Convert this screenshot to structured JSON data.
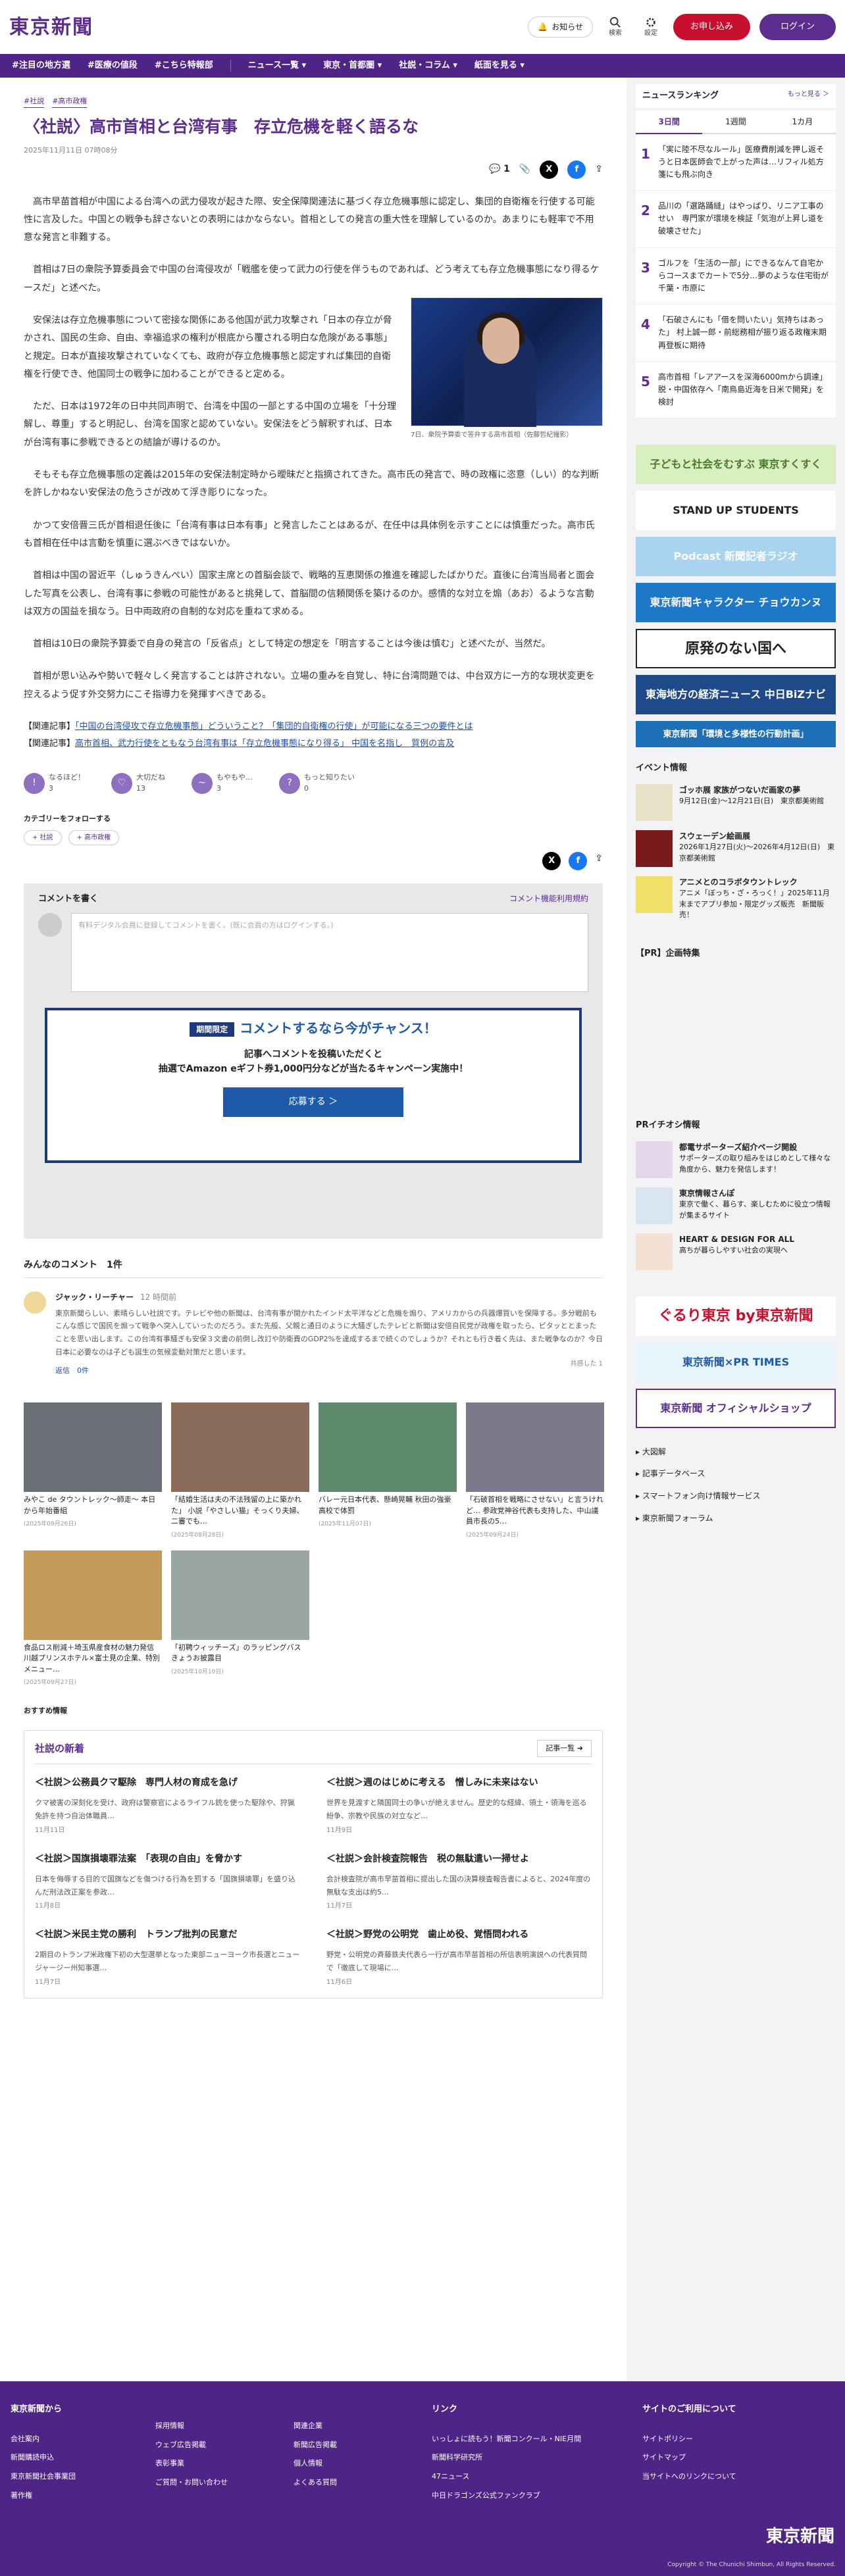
{
  "header": {
    "logo": "東京新聞",
    "notice": "お知らせ",
    "search": "検索",
    "settings": "設定",
    "subscribe": "お申し込み",
    "login": "ログイン"
  },
  "nav": [
    "#注目の地方選",
    "#医療の値段",
    "#こちら特報部",
    "ニュース一覧 ▾",
    "東京・首都圏 ▾",
    "社説・コラム ▾",
    "紙面を見る ▾"
  ],
  "article": {
    "tags": [
      "#社説",
      "#高市政権"
    ],
    "title": "〈社説〉高市首相と台湾有事　存立危機を軽く語るな",
    "date": "2025年11月11日 07時08分",
    "comments_count": "1",
    "paragraphs": [
      "高市早苗首相が中国による台湾への武力侵攻が起きた際、安全保障関連法に基づく存立危機事態に認定し、集団的自衛権を行使する可能性に言及した。中国との戦争も辞さないとの表明にはかならない。首相としての発言の重大性を理解しているのか。あまりにも軽率で不用意な発言と非難する。",
      "首相は7日の衆院予算委員会で中国の台湾侵攻が「戦艦を使って武力の行使を伴うものであれば、どう考えても存立危機事態になり得るケースだ」と述べた。",
      "安保法は存立危機事態について密接な関係にある他国が武力攻撃され「日本の存立が脅かされ、国民の生命、自由、幸福追求の権利が根底から覆される明白な危険がある事態」と規定。日本が直接攻撃されていなくても、政府が存立危機事態と認定すれば集団的自衛権を行使でき、他国同士の戦争に加わることができると定める。",
      "ただ、日本は1972年の日中共同声明で、台湾を中国の一部とする中国の立場を「十分理解し、尊重」すると明記し、台湾を国家と認めていない。安保法をどう解釈すれば、日本が台湾有事に参戦できるとの結論が導けるのか。",
      "そもそも存立危機事態の定義は2015年の安保法制定時から曖昧だと指摘されてきた。高市氏の発言で、時の政権に恣意（しい）的な判断を許しかねない安保法の危うさが改めて浮き彫りになった。",
      "かつて安倍晋三氏が首相退任後に「台湾有事は日本有事」と発言したことはあるが、在任中は具体例を示すことには慎重だった。高市氏も首相在任中は言動を慎重に選ぶべきではないか。",
      "首相は中国の習近平（しゅうきんぺい）国家主席との首脳会談で、戦略的互恵関係の推進を確認したばかりだ。直後に台湾当局者と面会した写真を公表し、台湾有事に参戦の可能性があると挑発して、首脳間の信頼関係を築けるのか。感情的な対立を煽（あお）るような言動は双方の国益を損なう。日中両政府の自制的な対応を重ねて求める。",
      "首相は10日の衆院予算委で自身の発言の「反省点」として特定の想定を「明言することは今後は慎む」と述べたが、当然だ。",
      "首相が思い込みや勢いで軽々しく発言することは許されない。立場の重みを自覚し、特に台湾問題では、中台双方に一方的な現状変更を控えるよう促す外交努力にこそ指導力を発揮すべきである。"
    ],
    "fig_caption": "7日、衆院予算委で答弁する高市首相（佐藤哲紀撮影）",
    "related": [
      {
        "label": "【関連記事】",
        "text": "「中国の台湾侵攻で存立危機事態」どういうこと？「集団的自衛権の行使」が可能になる三つの要件とは"
      },
      {
        "label": "【関連記事】",
        "text": "高市首相、武力行使をともなう台湾有事は「存立危機事態になり得る」 中国を名指し　質例の言及"
      }
    ],
    "reactions": [
      {
        "label": "なるほど！",
        "n": "3"
      },
      {
        "label": "大切だね",
        "n": "13"
      },
      {
        "label": "もやもや…",
        "n": "3"
      },
      {
        "label": "もっと知りたい",
        "n": "0"
      }
    ],
    "follow_label": "カテゴリーをフォローする",
    "follow_tags": [
      "+ 社説",
      "+ 高市政権"
    ]
  },
  "comments": {
    "write": "コメントを書く",
    "policy": "コメント機能利用規約",
    "input": "有料デジタル会員に登録してコメントを書く。(既に会員の方はログインする。)",
    "camp_badge": "期間限定",
    "camp_title": "コメントするなら今がチャンス！",
    "camp_desc": "記事へコメントを投稿いただくと\n抽選でAmazon eギフト券1,000円分などが当たるキャンペーン実施中！",
    "camp_btn": "応募する ＞",
    "header": "みんなのコメント　1件",
    "user": "ジャック・リーチャー",
    "time": "12 時間前",
    "text": "東京新聞らしい、素晴らしい社説です。テレビや他の新聞は、台湾有事が開かれたインド太平洋などと危機を煽り、アメリカからの兵器爆買いを保障する。多分戦前もこんな感じで国民を煽って戦争へ突入していったのだろう。また先般、父親と通日のように大騒ぎしたテレビと新聞は安倍自民党が政権を取ったら、ピタッととまったことを思い出します。この台湾有事騒ぎも安保３文書の前倒し改訂や防衛費のGDP2%を達成するまで続くのでしょうか？それとも行き着く先は、また戦争なのか？今日日本に必要なのは子ども誕生の気候変動対策だと思います。",
    "reply": "返信　0件",
    "flag": "共感した 1"
  },
  "cards": [
    {
      "t": "みやこ de タウントレック〜師走〜 本日から年始番組",
      "d": "(2025年09月26日)"
    },
    {
      "t": "「結婚生活は夫の不法残留の上に築かれた」 小説「やさしい猫」そっくり夫婦、二審でも…",
      "d": "(2025年08月28日)"
    },
    {
      "t": "バレー元日本代表、懸崎晃輔 秋田の強豪高校で体罰",
      "d": "(2025年11月07日)"
    },
    {
      "t": "「石破首相を戦略にさせない」と言うけれど… 参政党神谷代表も支持した、中山議員市長の5…",
      "d": "(2025年09月24日)"
    },
    {
      "t": "食品ロス削減＋埼玉県産食材の魅力発信 川越プリンスホテル×富士見の企業、特別メニュー…",
      "d": "(2025年09月27日)"
    },
    {
      "t": "「初聘ウィッチーズ」のラッピングバス きょうお披露目",
      "d": "(2025年10月10日)"
    }
  ],
  "recommend": "おすすめ情報",
  "shinchaku": {
    "title": "社説の新着",
    "more": "記事一覧 ➜",
    "items": [
      {
        "t": "＜社説＞公務員クマ駆除　専門人材の育成を急げ",
        "d": "クマ被害の深刻化を受け、政府は警察官によるライフル銃を使った駆除や、狩猟免許を持つ自治体職員…",
        "dt": "11月11日"
      },
      {
        "t": "＜社説＞週のはじめに考える　憎しみに未来はない",
        "d": "世界を見渡すと隣国同士の争いが絶えません。歴史的な経緯、領土・領海を巡る紛争、宗教や民族の対立など…",
        "dt": "11月9日"
      },
      {
        "t": "＜社説＞国旗損壊罪法案　「表現の自由」を脅かす",
        "d": "日本を侮辱する目的で国旗などを傷つける行為を罰する「国旗損壊罪」を盛り込んだ刑法改正案を参政…",
        "dt": "11月8日"
      },
      {
        "t": "＜社説＞会計検査院報告　税の無駄遣い一掃せよ",
        "d": "会計検査院が高市早苗首相に提出した国の決算検査報告書によると、2024年度の無駄な支出は約5…",
        "dt": "11月7日"
      },
      {
        "t": "＜社説＞米民主党の勝利　トランプ批判の民意だ",
        "d": "2期目のトランプ米政権下初の大型選挙となった東部ニューヨーク市長選とニュージャージー州知事選…",
        "dt": "11月7日"
      },
      {
        "t": "＜社説＞野党の公明党　歯止め役、覚悟問われる",
        "d": "野党・公明党の斉藤鉄夫代表ら一行が高市早苗首相の所信表明演説への代表質問で「徹底して現場に…",
        "dt": "11月6日"
      }
    ]
  },
  "ranking": {
    "title": "ニュースランキング",
    "more": "もっと見る ＞",
    "tabs": [
      "3日間",
      "1週間",
      "1カ月"
    ],
    "items": [
      "「実に陸不尽なルール」医療費削減を押し返そうと日本医師会で上がった声は…リフィル処方箋にも飛ぶ向き",
      "品川の「選路踊縫」はやっぱり、リニア工事のせい　専門家が環境を検証「気泡が上昇し道を破壊させた」",
      "ゴルフを「生活の一部」にできるなんて自宅からコースまでカートで5分…夢のような住宅街が千葉・市原に",
      "「石破さんにも「借を問いたい」気持ちはあった」 村上誠一郎・前総務相が振り返る政権末期　再登板に期待",
      "高市首相「レアアースを深海6000mから調達」 脱・中国依存へ「南鳥島近海を日米で開発」を検討"
    ]
  },
  "side_ads": [
    "子どもと社会をむすぶ 東京すくすく",
    "STAND UP STUDENTS",
    "Podcast 新聞記者ラジオ",
    "東京新聞キャラクター チョウカンヌ",
    "原発のない国へ",
    "東海地方の経済ニュース 中日BiZナビ",
    "東京新聞「環境と多様性の行動計画」"
  ],
  "events": {
    "title": "イベント情報",
    "items": [
      {
        "t": "ゴッホ展 家族がつないだ画家の夢",
        "d": "9月12日(金)〜12月21日(日)　東京都美術館"
      },
      {
        "t": "スウェーデン絵画展",
        "d": "2026年1月27日(火)〜2026年4月12日(日)　東京都美術館"
      },
      {
        "t": "アニメとのコラボタウントレック",
        "d": "アニメ「ぼっち・ざ・ろっく！」2025年11月末までアプリ参加・限定グッズ販売　新聞販売！"
      }
    ]
  },
  "pr_title": "【PR】企画特集",
  "pri": {
    "title": "PRイチオシ情報",
    "items": [
      {
        "t": "都電サポーターズ紹介ページ開設",
        "d": "サポーターズの取り組みをはじめとして様々な角度から、魅力を発信します！"
      },
      {
        "t": "東京情報さんぽ",
        "d": "東京で働く、暮らす、楽しむために役立つ情報が集まるサイト"
      },
      {
        "t": "HEART & DESIGN FOR ALL",
        "d": "高ちが暮らしやすい社会の実現へ"
      }
    ]
  },
  "side_banners": [
    "ぐるり東京 by東京新聞",
    "東京新聞×PR TIMES",
    "東京新聞 オフィシャルショップ"
  ],
  "side_links": [
    "大図解",
    "記事データベース",
    "スマートフォン向け情報サービス",
    "東京新聞フォーラム"
  ],
  "footer": {
    "c1": {
      "h": "東京新聞から",
      "items": [
        "会社案内",
        "新聞購読申込",
        "東京新聞社会事業団",
        "著作権"
      ]
    },
    "c2": {
      "items": [
        "採用情報",
        "ウェブ広告掲載",
        "表彰事業",
        "ご質問・お問い合わせ"
      ]
    },
    "c3": {
      "items": [
        "関連企業",
        "新聞広告掲載",
        "個人情報",
        "よくある質問"
      ]
    },
    "c4": {
      "h": "リンク",
      "items": [
        "いっしょに読もう！新聞コンクール・NIE月間",
        "新聞科学研究所",
        "47ニュース",
        "中日ドラゴンズ公式ファンクラブ"
      ]
    },
    "c5": {
      "h": "サイトのご利用について",
      "items": [
        "サイトポリシー",
        "サイトマップ",
        "当サイトへのリンクについて"
      ]
    },
    "logo": "東京新聞",
    "copy": "Copyright © The Chunichi Shimbun, All Rights Reserved."
  }
}
